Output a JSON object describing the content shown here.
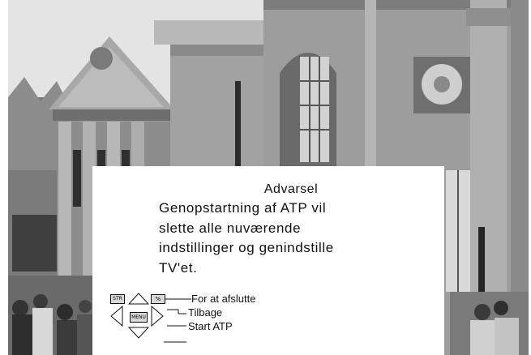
{
  "dialog": {
    "title": "Advarsel",
    "message_lines": [
      "Genopstartning af ATP vil",
      "slette alle nuværende",
      "indstillinger og genindstille",
      "TV'et."
    ]
  },
  "keys": {
    "str_label": "STR",
    "menu_label": "MENU",
    "ok_label": "%"
  },
  "legend": {
    "exit": "For at afslutte",
    "back": "Tilbage",
    "start": "Start ATP"
  },
  "icons": {
    "up": "triangle-up-icon",
    "down": "triangle-down-icon",
    "left": "triangle-left-icon",
    "right": "triangle-right-icon"
  },
  "colors": {
    "dialog_background": "#ffffff",
    "key_fill": "#d9d9d9",
    "line": "#111111"
  }
}
